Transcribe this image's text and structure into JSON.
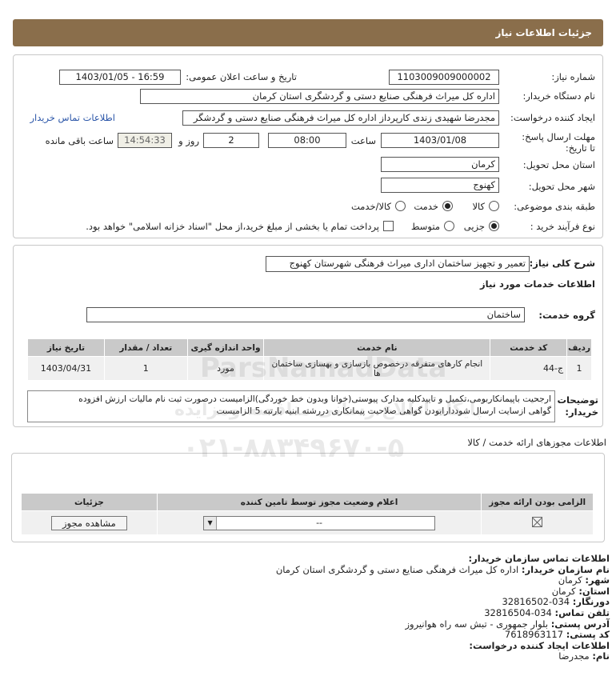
{
  "header": {
    "title": "جزئیات اطلاعات نیاز"
  },
  "info": {
    "need_number_label": "شماره نیاز:",
    "need_number": "1103009009000002",
    "announce_label": "تاریخ و ساعت اعلان عمومی:",
    "announce_value": "1403/01/05 - 16:59",
    "buyer_label": "نام دستگاه خریدار:",
    "buyer_value": "اداره کل میراث فرهنگی  صنایع دستی و گردشگری استان کرمان",
    "creator_label": "ایجاد کننده درخواست:",
    "creator_value": "مجدرضا شهیدی زندی کارپرداز اداره کل میراث فرهنگی  صنایع دستی و گردشگر",
    "contact_link": "اطلاعات تماس خریدار",
    "deadline_label": "مهلت ارسال پاسخ: تا تاریخ:",
    "deadline_date": "1403/01/08",
    "time_label": "ساعت",
    "deadline_time": "08:00",
    "days_value": "2",
    "days_label": "روز و",
    "remaining_time": "14:54:33",
    "remaining_label": "ساعت باقی مانده",
    "province_label": "استان محل تحویل:",
    "province_value": "کرمان",
    "city_label": "شهر محل تحویل:",
    "city_value": "کهنوج",
    "category_label": "طبقه بندی موضوعی:",
    "category_options": [
      "کالا",
      "خدمت",
      "کالا/خدمت"
    ],
    "category_selected": "خدمت",
    "process_label": "نوع فرآیند خرید :",
    "process_options": [
      "جزیی",
      "متوسط"
    ],
    "process_selected": "جزیی",
    "payment_note": "پرداخت تمام یا بخشی از مبلغ خرید،از محل \"اسناد خزانه اسلامی\" خواهد بود."
  },
  "need": {
    "desc_label": "شرح کلی نیاز:",
    "desc_value": "تعمیر و تجهیز ساختمان اداری میراث فرهنگی شهرستان کهنوج",
    "services_title": "اطلاعات خدمات مورد نیاز",
    "group_label": "گروه خدمت:",
    "group_value": "ساختمان",
    "table_headers": [
      "ردیف",
      "کد خدمت",
      "نام خدمت",
      "واحد اندازه گیری",
      "تعداد / مقدار",
      "تاریخ نیاز"
    ],
    "rows": [
      {
        "index": "1",
        "code": "ج-44",
        "name": "انجام کارهای متفرقه درخصوص بازسازی و بهسازی ساختمان ها",
        "unit": "مورد",
        "qty": "1",
        "date": "1403/04/31"
      }
    ],
    "buyer_notes_label": "توضیحات خریدار:",
    "buyer_notes_line1": "ارجحیت باپیمانکاربومی،تکمیل و تاییدکلیه مدارک پیوستی(خوانا وبدون خط خوردگی)الزامیست درصورت ثبت نام مالیات ارزش افزوده",
    "buyer_notes_line2": "گواهی ازسایت ارسال شوددارابودن گواهی صلاحیت پیمانکاری دررشته ابنیه بارتبه 5 الزامیست"
  },
  "licenses": {
    "title": "اطلاعات مجوزهای ارائه خدمت / کالا",
    "headers": [
      "الزامی بودن ارائه مجوز",
      "اعلام وضعیت مجوز توسط تامین کننده",
      "جزئیات"
    ],
    "select_value": "--",
    "view_button": "مشاهده مجوز"
  },
  "contact": {
    "title": "اطلاعات تماس سازمان خریدار:",
    "org_label": "نام سازمان خریدار:",
    "org_value": "اداره کل میراث فرهنگی صنایع دستی و گردشگری استان کرمان",
    "city_label": "شهر:",
    "city_value": "کرمان",
    "province_label": "استان:",
    "province_value": "کرمان",
    "fax_label": "دورنگار:",
    "fax_value": "034-32816502",
    "phone_label": "تلفن تماس:",
    "phone_value": "034-32816504",
    "address_label": "آدرس پستی:",
    "address_value": "بلوار جمهوری - تبش سه راه هوانیروز",
    "postal_label": "کد پستی:",
    "postal_value": "7618963117",
    "creator_title": "اطلاعات ایجاد کننده درخواست:",
    "name_label": "نام:",
    "name_value": "مجدرضا"
  },
  "watermark": {
    "brand": "ParsNamadData",
    "line1": "پایگاه اطلاع رسانی مناقصه ومزایده",
    "phone": "۰۲۱-۸۸۳۴۹۶۷۰-۵"
  }
}
